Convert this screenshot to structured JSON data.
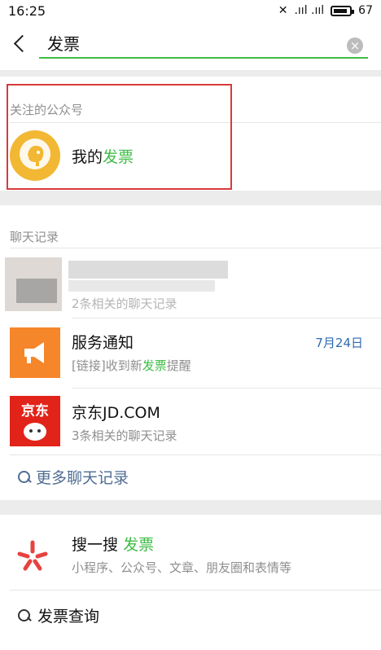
{
  "status_bar": {
    "time": "16:25",
    "signal": ".ııl .ııl",
    "battery": "67"
  },
  "search": {
    "query": "发票",
    "clear_icon": "×"
  },
  "official_accounts": {
    "title": "关注的公众号",
    "items": [
      {
        "name_prefix": "我的",
        "name_highlight": "发票",
        "icon": "elephant-logo"
      }
    ]
  },
  "chat_records": {
    "title": "聊天记录",
    "items": [
      {
        "name": "",
        "subtitle": "2条相关的聊天记录",
        "blurred": true
      },
      {
        "name": "服务通知",
        "subtitle_prefix": "[链接]收到新",
        "subtitle_highlight": "发票",
        "subtitle_suffix": "提醒",
        "date": "7月24日",
        "icon": "megaphone-icon"
      },
      {
        "name": "京东JD.COM",
        "subtitle": "3条相关的聊天记录",
        "icon": "jd-logo"
      }
    ],
    "more": "更多聊天记录"
  },
  "sousou": {
    "title": "搜一搜",
    "keyword": "发票",
    "subtitle": "小程序、公众号、文章、朋友圈和表情等"
  },
  "suggestion": {
    "text": "发票查询"
  },
  "colors": {
    "accent": "#3ebd46",
    "link": "#4f6d92",
    "date": "#2f6bb2",
    "highlight_box": "#d93a3a"
  }
}
